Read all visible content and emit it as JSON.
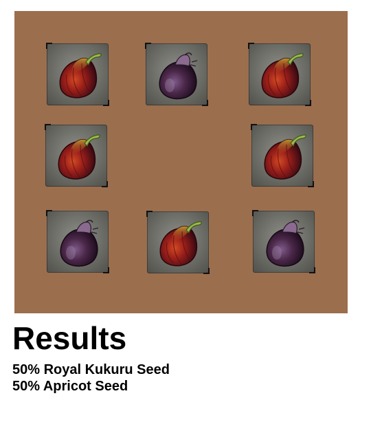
{
  "seed_grid": {
    "slots": [
      {
        "icon": "royal-kukuru-seed-icon"
      },
      {
        "icon": "apricot-seed-icon"
      },
      {
        "icon": "royal-kukuru-seed-icon"
      },
      {
        "icon": "royal-kukuru-seed-icon"
      },
      {
        "icon": "royal-kukuru-seed-icon"
      },
      {
        "icon": "apricot-seed-icon"
      },
      {
        "icon": "royal-kukuru-seed-icon"
      },
      {
        "icon": "apricot-seed-icon"
      }
    ]
  },
  "results": {
    "title": "Results",
    "lines": [
      "50% Royal Kukuru Seed",
      "50% Apricot Seed"
    ]
  },
  "colors": {
    "panel_background": "#9b6e4e",
    "slot_background": "#6c6d66",
    "royal_kukuru_seed": "#8b1a1a",
    "apricot_seed": "#3e1f3f"
  }
}
